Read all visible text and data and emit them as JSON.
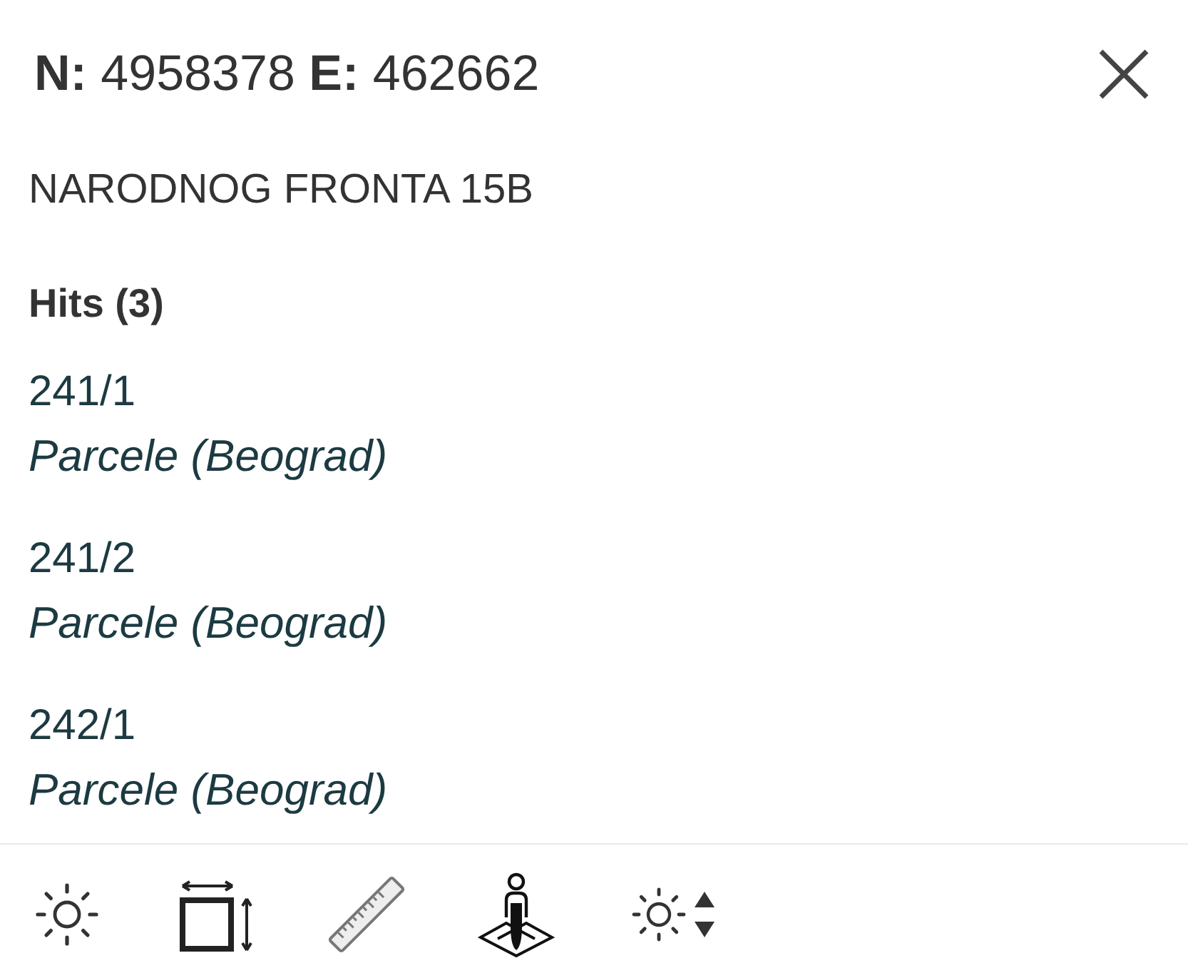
{
  "header": {
    "coordinates": "**N:** 4958378 **E:** 462662"
  },
  "address": "NARODNOG FRONTA 15B",
  "hits": {
    "heading": "Hits (3)",
    "items": [
      {
        "id": "241/1",
        "layer": "Parcele (Beograd)"
      },
      {
        "id": "241/2",
        "layer": "Parcele (Beograd)"
      },
      {
        "id": "242/1",
        "layer": "Parcele (Beograd)"
      }
    ]
  }
}
